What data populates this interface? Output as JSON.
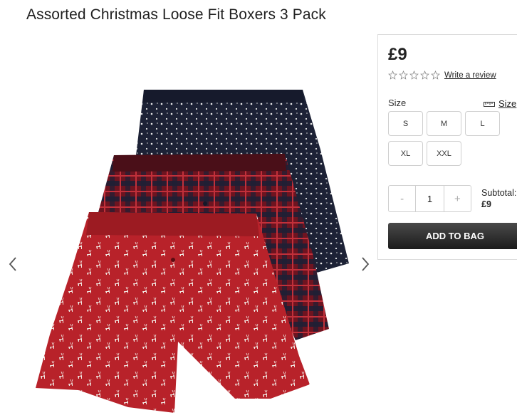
{
  "product": {
    "title": "Assorted Christmas Loose Fit Boxers 3 Pack",
    "image_icon": "boxers-product-image"
  },
  "gallery": {
    "prev_icon": "chevron-left-icon",
    "next_icon": "chevron-right-icon"
  },
  "panel": {
    "price": "£9",
    "rating": {
      "stars": 0,
      "max": 5,
      "review_link": "Write a review"
    },
    "size_label": "Size",
    "size_guide_label": "Size",
    "sizes": [
      "S",
      "M",
      "L",
      "XL",
      "XXL"
    ],
    "quantity": "1",
    "qty_minus": "-",
    "qty_plus": "+",
    "subtotal_label": "Subtotal:",
    "subtotal_value": "£9",
    "add_to_bag": "ADD TO BAG"
  },
  "colors": {
    "red": "#b8222a",
    "navy": "#1c2038",
    "button_dark": "#222222"
  }
}
